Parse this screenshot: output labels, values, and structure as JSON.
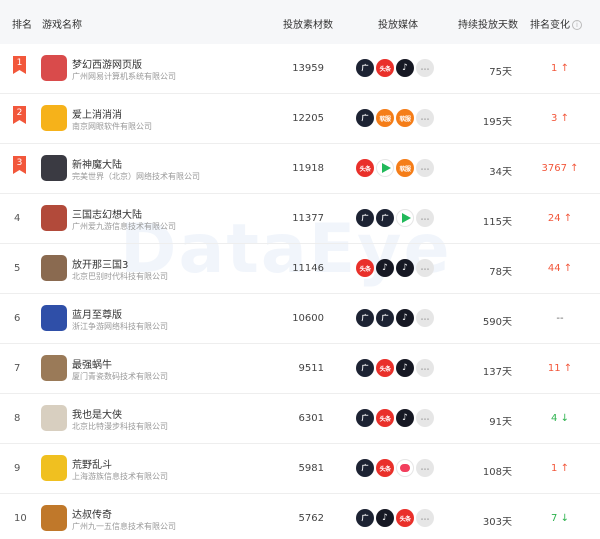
{
  "header": {
    "rank": "排名",
    "name": "游戏名称",
    "count": "投放素材数",
    "media": "投放媒体",
    "days": "持续投放天数",
    "change": "排名变化"
  },
  "watermark": "DataEye",
  "media_labels": {
    "guang": "广",
    "toutiao": "头条",
    "douyin": "♪",
    "ruankuang": "软服",
    "more": "…"
  },
  "rows": [
    {
      "rank": "1",
      "name": "梦幻西游网页版",
      "company": "广州网易计算机系统有限公司",
      "count": "13959",
      "days": "75天",
      "change": "1",
      "arrow": "↑",
      "icon_color": "#d94b4b"
    },
    {
      "rank": "2",
      "name": "爱上消消消",
      "company": "南京网眼软件有限公司",
      "count": "12205",
      "days": "195天",
      "change": "3",
      "arrow": "↑",
      "icon_color": "#f6b21a"
    },
    {
      "rank": "3",
      "name": "新神魔大陆",
      "company": "完美世界（北京）网络技术有限公司",
      "count": "11918",
      "days": "34天",
      "change": "3767",
      "arrow": "↑",
      "icon_color": "#3a3a42"
    },
    {
      "rank": "4",
      "name": "三国志幻想大陆",
      "company": "广州爱九游信息技术有限公司",
      "count": "11377",
      "days": "115天",
      "change": "24",
      "arrow": "↑",
      "icon_color": "#b24a3a"
    },
    {
      "rank": "5",
      "name": "放开那三国3",
      "company": "北京巴别时代科技有限公司",
      "count": "11146",
      "days": "78天",
      "change": "44",
      "arrow": "↑",
      "icon_color": "#8a6a50"
    },
    {
      "rank": "6",
      "name": "蓝月至尊版",
      "company": "浙江争游网络科技有限公司",
      "count": "10600",
      "days": "590天",
      "change": "--",
      "arrow": "",
      "icon_color": "#2f4fa8"
    },
    {
      "rank": "7",
      "name": "最强蜗牛",
      "company": "厦门青瓷数码技术有限公司",
      "count": "9511",
      "days": "137天",
      "change": "11",
      "arrow": "↑",
      "icon_color": "#9a7a58"
    },
    {
      "rank": "8",
      "name": "我也是大侠",
      "company": "北京比特漫步科技有限公司",
      "count": "6301",
      "days": "91天",
      "change": "4",
      "arrow": "↓",
      "icon_color": "#d8cfc0"
    },
    {
      "rank": "9",
      "name": "荒野乱斗",
      "company": "上海游族信息技术有限公司",
      "count": "5981",
      "days": "108天",
      "change": "1",
      "arrow": "↑",
      "icon_color": "#f0c020"
    },
    {
      "rank": "10",
      "name": "达叔传奇",
      "company": "广州九一五信息技术有限公司",
      "count": "5762",
      "days": "303天",
      "change": "7",
      "arrow": "↓",
      "icon_color": "#c0782a"
    }
  ]
}
